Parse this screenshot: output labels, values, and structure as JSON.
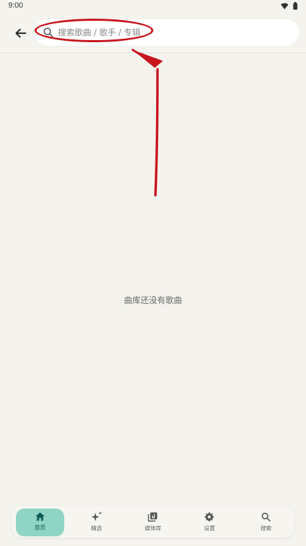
{
  "status_bar": {
    "time": "9:00",
    "icons": [
      "wifi-icon",
      "battery-icon"
    ]
  },
  "header": {
    "back_icon": "arrow-left-icon",
    "search": {
      "icon": "search-icon",
      "placeholder": "搜索歌曲 / 歌手 / 专辑",
      "value": ""
    }
  },
  "main": {
    "empty_message": "曲库还没有歌曲"
  },
  "annotation": {
    "color": "#c8141c"
  },
  "bottom_nav": {
    "items": [
      {
        "label": "首页",
        "icon": "home-icon",
        "active": true
      },
      {
        "label": "精选",
        "icon": "sparkle-icon",
        "active": false
      },
      {
        "label": "媒体库",
        "icon": "library-icon",
        "active": false
      },
      {
        "label": "设置",
        "icon": "gear-icon",
        "active": false
      },
      {
        "label": "搜索",
        "icon": "search-icon",
        "active": false
      }
    ],
    "active_color": "#8fd4c5"
  }
}
